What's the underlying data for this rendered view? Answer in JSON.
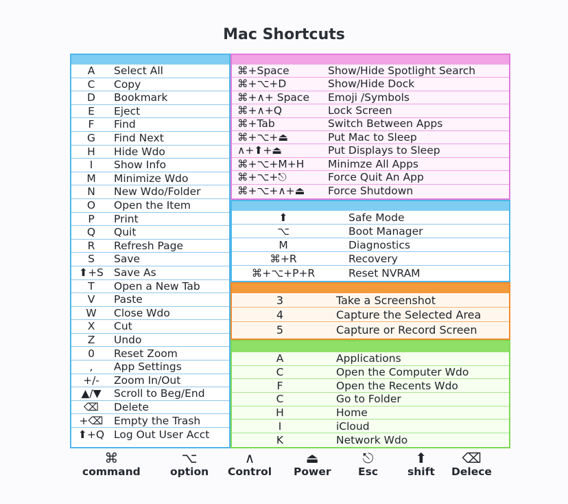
{
  "title": "Mac Shortcuts",
  "left": [
    {
      "key": "A",
      "desc": "Select All"
    },
    {
      "key": "C",
      "desc": "Copy"
    },
    {
      "key": "D",
      "desc": "Bookmark"
    },
    {
      "key": "E",
      "desc": "Eject"
    },
    {
      "key": "F",
      "desc": "Find"
    },
    {
      "key": "G",
      "desc": "Find Next"
    },
    {
      "key": "H",
      "desc": "Hide Wdo"
    },
    {
      "key": "I",
      "desc": "Show Info"
    },
    {
      "key": "M",
      "desc": "Minimize Wdo"
    },
    {
      "key": "N",
      "desc": "New Wdo/Folder"
    },
    {
      "key": "O",
      "desc": "Open the Item"
    },
    {
      "key": "P",
      "desc": "Print"
    },
    {
      "key": "Q",
      "desc": "Quit"
    },
    {
      "key": "R",
      "desc": "Refresh Page"
    },
    {
      "key": "S",
      "desc": "Save"
    },
    {
      "key": "⬆+S",
      "desc": "Save As"
    },
    {
      "key": "T",
      "desc": "Open a New Tab"
    },
    {
      "key": "V",
      "desc": "Paste"
    },
    {
      "key": "W",
      "desc": "Close Wdo"
    },
    {
      "key": "X",
      "desc": "Cut"
    },
    {
      "key": "Z",
      "desc": "Undo"
    },
    {
      "key": "0",
      "desc": "Reset Zoom"
    },
    {
      "key": ",",
      "desc": "App Settings"
    },
    {
      "key": "+/-",
      "desc": "Zoom In/Out"
    },
    {
      "key": "▲/▼",
      "desc": "Scroll to Beg/End"
    },
    {
      "key": "⌫",
      "desc": "Delete"
    },
    {
      "key": "+⌫",
      "desc": "Empty the Trash"
    },
    {
      "key": "⬆+Q",
      "desc": "Log Out User Acct"
    }
  ],
  "pink": [
    {
      "key": "⌘+Space",
      "desc": "Show/Hide Spotlight Search"
    },
    {
      "key": "⌘+⌥+D",
      "desc": "Show/Hide Dock"
    },
    {
      "key": "⌘+∧+ Space",
      "desc": "Emoji /Symbols"
    },
    {
      "key": "⌘+∧+Q",
      "desc": "Lock Screen"
    },
    {
      "key": "⌘+Tab",
      "desc": "Switch Between Apps"
    },
    {
      "key": "⌘+⌥+⏏",
      "desc": "Put Mac to Sleep"
    },
    {
      "key": "∧+⬆+⏏",
      "desc": "Put Displays to Sleep"
    },
    {
      "key": "⌘+⌥+M+H",
      "desc": "Minimze All Apps"
    },
    {
      "key": "⌘+⌥+⎋",
      "desc": "Force Quit An App"
    },
    {
      "key": "⌘+⌥+∧+⏏",
      "desc": "Force Shutdown"
    }
  ],
  "startup": [
    {
      "key": "⬆",
      "desc": "Safe Mode"
    },
    {
      "key": "⌥",
      "desc": "Boot Manager"
    },
    {
      "key": "M",
      "desc": "Diagnostics"
    },
    {
      "key": "⌘+R",
      "desc": "Recovery"
    },
    {
      "key": "⌘+⌥+P+R",
      "desc": "Reset NVRAM"
    }
  ],
  "screenshot": [
    {
      "key": "3",
      "desc": "Take a Screenshot"
    },
    {
      "key": "4",
      "desc": "Capture the Selected Area"
    },
    {
      "key": "5",
      "desc": "Capture or Record Screen"
    }
  ],
  "finder": [
    {
      "key": "A",
      "desc": "Applications"
    },
    {
      "key": "C",
      "desc": "Open the Computer Wdo"
    },
    {
      "key": "F",
      "desc": "Open the Recents Wdo"
    },
    {
      "key": "C",
      "desc": "Go to Folder"
    },
    {
      "key": "H",
      "desc": "Home"
    },
    {
      "key": "I",
      "desc": "iCloud"
    },
    {
      "key": "K",
      "desc": "Network Wdo"
    }
  ],
  "legend": [
    {
      "symbol": "⌘",
      "label": "command",
      "icon": "command-icon"
    },
    {
      "symbol": "⌥",
      "label": "option",
      "icon": "option-icon"
    },
    {
      "symbol": "∧",
      "label": "Control",
      "icon": "control-icon"
    },
    {
      "symbol": "⏏",
      "label": "Power",
      "icon": "power-icon"
    },
    {
      "symbol": "⎋",
      "label": "Esc",
      "icon": "esc-icon"
    },
    {
      "symbol": "⬆",
      "label": "shift",
      "icon": "shift-icon"
    },
    {
      "symbol": "⌫",
      "label": "Delece",
      "icon": "delete-icon"
    }
  ],
  "colors": {
    "blue": "#4db6ea",
    "pink": "#e27ad9",
    "orange": "#f18a2a",
    "green": "#7ed957"
  }
}
